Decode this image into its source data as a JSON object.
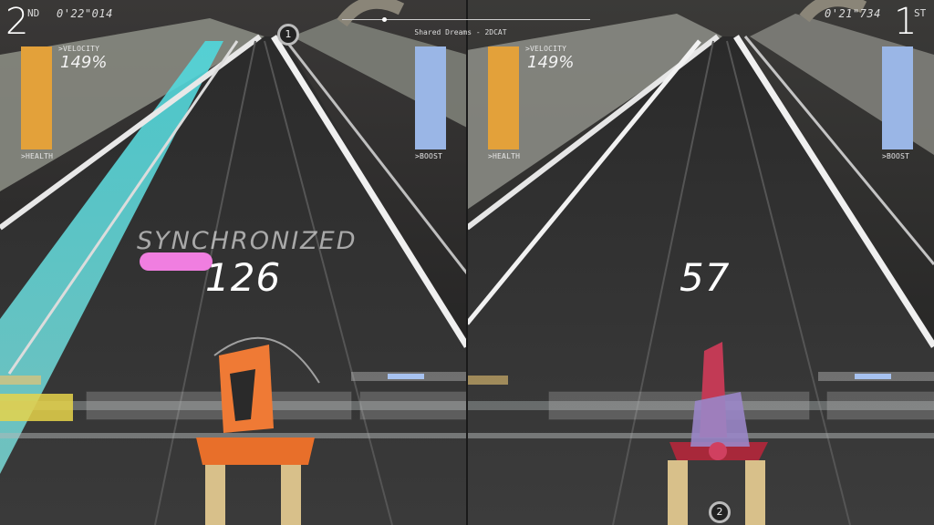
{
  "song": {
    "title": "Shared Dreams - 2DCAT",
    "progress_fraction": 0.17
  },
  "colors": {
    "health": "#e3a13a",
    "boost": "#9ab6e6",
    "sync_pill": "#f07ee0"
  },
  "players": {
    "left": {
      "position": "2",
      "position_suffix": "ND",
      "lap_time": "0'22\"014",
      "velocity_label": ">VELOCITY",
      "velocity_value": "149%",
      "health_label": ">HEALTH",
      "health_level": 1.0,
      "boost_label": ">BOOST",
      "boost_level": 1.0,
      "score": "126",
      "status_text": "SYNCHRONIZED",
      "marker": "1"
    },
    "right": {
      "position": "1",
      "position_suffix": "ST",
      "lap_time": "0'21\"734",
      "velocity_label": ">VELOCITY",
      "velocity_value": "149%",
      "health_label": ">HEALTH",
      "health_level": 1.0,
      "boost_label": ">BOOST",
      "boost_level": 1.0,
      "score": "57",
      "marker": "2"
    }
  }
}
